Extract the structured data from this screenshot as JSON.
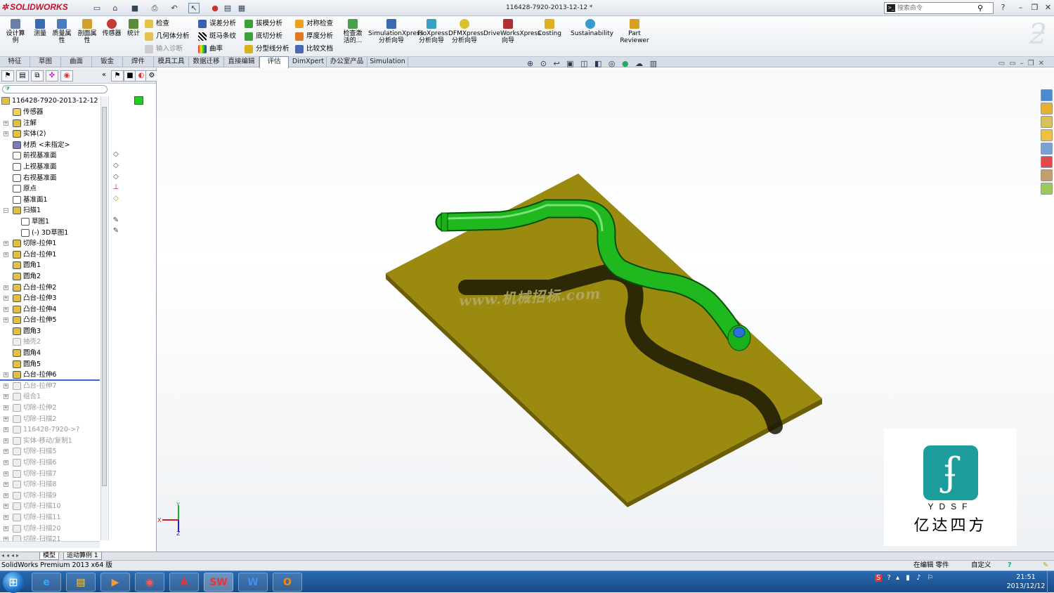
{
  "app": {
    "brand": "SOLIDWORKS",
    "title": "116428-7920-2013-12-12 *",
    "search_placeholder": "搜索命令"
  },
  "ribbon": {
    "big": [
      "设计算例",
      "测量",
      "质量属性",
      "剖面属性",
      "传感器",
      "统计"
    ],
    "col1": [
      "检查",
      "几何体分析",
      "输入诊断"
    ],
    "col2": [
      "误差分析",
      "斑马条纹",
      "曲率"
    ],
    "col3": [
      "拔模分析",
      "底切分析",
      "分型线分析"
    ],
    "col4": [
      "对称检查",
      "厚度分析",
      "比较文档"
    ],
    "check_active": "检查激活的...",
    "tools": [
      "SimulationXpress 分析向导",
      "FloXpress 分析向导",
      "DFMXpress 分析向导",
      "DriveWorksXpress 向导",
      "Costing",
      "Sustainability",
      "Part Reviewer"
    ]
  },
  "tabs": [
    "特征",
    "草图",
    "曲面",
    "钣金",
    "焊件",
    "模具工具",
    "数据迁移",
    "直接编辑",
    "评估",
    "DimXpert",
    "办公室产品",
    "Simulation"
  ],
  "active_tab": "评估",
  "tree": {
    "root": "116428-7920-2013-12-12 （",
    "items": [
      {
        "label": "传感器",
        "state": "normal",
        "icon": "sensor-icon"
      },
      {
        "label": "注解",
        "state": "normal",
        "icon": "annotation-icon"
      },
      {
        "label": "实体(2)",
        "state": "normal",
        "icon": "solid-bodies-icon"
      },
      {
        "label": "材质 <未指定>",
        "state": "normal",
        "icon": "material-icon"
      },
      {
        "label": "前视基准面",
        "state": "normal",
        "icon": "plane-icon"
      },
      {
        "label": "上视基准面",
        "state": "normal",
        "icon": "plane-icon"
      },
      {
        "label": "右视基准面",
        "state": "normal",
        "icon": "plane-icon"
      },
      {
        "label": "原点",
        "state": "normal",
        "icon": "origin-icon"
      },
      {
        "label": "基准面1",
        "state": "normal",
        "icon": "plane-icon"
      },
      {
        "label": "扫描1",
        "state": "normal",
        "icon": "sweep-icon"
      },
      {
        "label": "草图1",
        "state": "normal",
        "icon": "sketch-icon"
      },
      {
        "label": "(-) 3D草图1",
        "state": "normal",
        "icon": "sketch3d-icon"
      },
      {
        "label": "切除-拉伸1",
        "state": "normal",
        "icon": "cut-extrude-icon"
      },
      {
        "label": "凸台-拉伸1",
        "state": "normal",
        "icon": "boss-extrude-icon"
      },
      {
        "label": "圆角1",
        "state": "normal",
        "icon": "fillet-icon"
      },
      {
        "label": "圆角2",
        "state": "normal",
        "icon": "fillet-icon"
      },
      {
        "label": "凸台-拉伸2",
        "state": "normal",
        "icon": "boss-extrude-icon"
      },
      {
        "label": "凸台-拉伸3",
        "state": "normal",
        "icon": "boss-extrude-icon"
      },
      {
        "label": "凸台-拉伸4",
        "state": "normal",
        "icon": "boss-extrude-icon"
      },
      {
        "label": "凸台-拉伸5",
        "state": "normal",
        "icon": "boss-extrude-icon"
      },
      {
        "label": "圆角3",
        "state": "normal",
        "icon": "fillet-icon"
      },
      {
        "label": "抽壳2",
        "state": "grey",
        "icon": "shell-icon"
      },
      {
        "label": "圆角4",
        "state": "normal",
        "icon": "fillet-icon"
      },
      {
        "label": "圆角5",
        "state": "normal",
        "icon": "fillet-icon"
      },
      {
        "label": "凸台-拉伸6",
        "state": "normal",
        "icon": "boss-extrude-icon"
      },
      {
        "label": "凸台-拉伸7",
        "state": "grey",
        "icon": "boss-extrude-icon"
      },
      {
        "label": "组合1",
        "state": "grey",
        "icon": "combine-icon"
      },
      {
        "label": "切除-拉伸2",
        "state": "grey",
        "icon": "cut-extrude-icon"
      },
      {
        "label": "切除-扫描2",
        "state": "grey",
        "icon": "cut-sweep-icon"
      },
      {
        "label": "116428-7920->?",
        "state": "grey",
        "icon": "part-icon"
      },
      {
        "label": "实体-移动/复制1",
        "state": "grey",
        "icon": "move-copy-icon"
      },
      {
        "label": "切除-扫描5",
        "state": "grey",
        "icon": "cut-sweep-icon"
      },
      {
        "label": "切除-扫描6",
        "state": "grey",
        "icon": "cut-sweep-icon"
      },
      {
        "label": "切除-扫描7",
        "state": "grey",
        "icon": "cut-sweep-icon"
      },
      {
        "label": "切除-扫描8",
        "state": "grey",
        "icon": "cut-sweep-icon"
      },
      {
        "label": "切除-扫描9",
        "state": "grey",
        "icon": "cut-sweep-icon"
      },
      {
        "label": "切除-扫描10",
        "state": "grey",
        "icon": "cut-sweep-icon"
      },
      {
        "label": "切除-扫描11",
        "state": "grey",
        "icon": "cut-sweep-icon"
      },
      {
        "label": "切除-扫描20",
        "state": "grey",
        "icon": "cut-sweep-icon"
      },
      {
        "label": "切除-扫描21",
        "state": "grey",
        "icon": "cut-sweep-icon"
      }
    ]
  },
  "viewport": {
    "watermark": "www.机械招标.com",
    "triad": {
      "x": "X",
      "y": "Y",
      "z": "Z"
    },
    "plate_color": "#9a8a10",
    "pipe_color": "#1fb81f"
  },
  "logo": {
    "en": "YDSF",
    "cn": "亿达四方",
    "color": "#1c9c9a"
  },
  "sheet_tabs": [
    "模型",
    "运动算例 1"
  ],
  "status": {
    "product": "SolidWorks Premium 2013 x64 版",
    "mode": "在编辑 零件",
    "units": "自定义"
  },
  "taskbar": {
    "time": "21:51",
    "date": "2013/12/12"
  }
}
